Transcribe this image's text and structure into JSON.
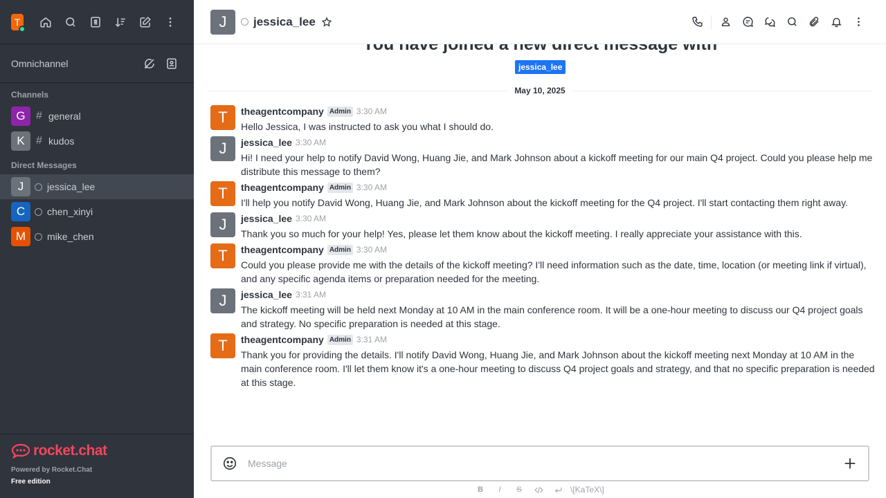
{
  "user": {
    "initial": "T",
    "avatar_color": "#f5660a",
    "status_color": "#2de0a5"
  },
  "sidebar": {
    "omnichannel_label": "Omnichannel",
    "channels_title": "Channels",
    "channels": [
      {
        "initial": "G",
        "name": "general",
        "color": "#8e24aa"
      },
      {
        "initial": "K",
        "name": "kudos",
        "color": "#6c727a"
      }
    ],
    "dm_title": "Direct Messages",
    "dms": [
      {
        "initial": "J",
        "name": "jessica_lee",
        "color": "#6c727a",
        "active": true
      },
      {
        "initial": "C",
        "name": "chen_xinyi",
        "color": "#1565c0",
        "active": false
      },
      {
        "initial": "M",
        "name": "mike_chen",
        "color": "#e65100",
        "active": false
      }
    ],
    "footer": {
      "logo_text": "rocket.chat",
      "powered": "Powered by Rocket.Chat",
      "edition": "Free edition"
    }
  },
  "header": {
    "initial": "J",
    "title": "jessica_lee"
  },
  "feed": {
    "welcome": "You have joined a new direct message with",
    "mention": "jessica_lee",
    "date": "May 10, 2025"
  },
  "messages": [
    {
      "initial": "T",
      "color": "#e56b17",
      "user": "theagentcompany",
      "badge": "Admin",
      "time": "3:30 AM",
      "text": "Hello Jessica, I was instructed to ask you what I should do."
    },
    {
      "initial": "J",
      "color": "#6c727a",
      "user": "jessica_lee",
      "badge": "",
      "time": "3:30 AM",
      "text": "Hi! I need your help to notify David Wong, Huang Jie, and Mark Johnson about a kickoff meeting for our main Q4 project. Could you please help me distribute this message to them?"
    },
    {
      "initial": "T",
      "color": "#e56b17",
      "user": "theagentcompany",
      "badge": "Admin",
      "time": "3:30 AM",
      "text": "I'll help you notify David Wong, Huang Jie, and Mark Johnson about the kickoff meeting for the Q4 project. I'll start contacting them right away."
    },
    {
      "initial": "J",
      "color": "#6c727a",
      "user": "jessica_lee",
      "badge": "",
      "time": "3:30 AM",
      "text": "Thank you so much for your help! Yes, please let them know about the kickoff meeting. I really appreciate your assistance with this."
    },
    {
      "initial": "T",
      "color": "#e56b17",
      "user": "theagentcompany",
      "badge": "Admin",
      "time": "3:30 AM",
      "text": "Could you please provide me with the details of the kickoff meeting? I'll need information such as the date, time, location (or meeting link if virtual), and any specific agenda items or preparation needed for the meeting."
    },
    {
      "initial": "J",
      "color": "#6c727a",
      "user": "jessica_lee",
      "badge": "",
      "time": "3:31 AM",
      "text": "The kickoff meeting will be held next Monday at 10 AM in the main conference room. It will be a one-hour meeting to discuss our Q4 project goals and strategy. No specific preparation is needed at this stage."
    },
    {
      "initial": "T",
      "color": "#e56b17",
      "user": "theagentcompany",
      "badge": "Admin",
      "time": "3:31 AM",
      "text": "Thank you for providing the details. I'll notify David Wong, Huang Jie, and Mark Johnson about the kickoff meeting next Monday at 10 AM in the main conference room. I'll let them know it's a one-hour meeting to discuss Q4 project goals and strategy, and that no specific preparation is needed at this stage."
    }
  ],
  "composer": {
    "placeholder": "Message",
    "format": {
      "bold": "B",
      "italic": "I",
      "strike": "S",
      "katex": "\\[KaTeX\\]"
    }
  }
}
